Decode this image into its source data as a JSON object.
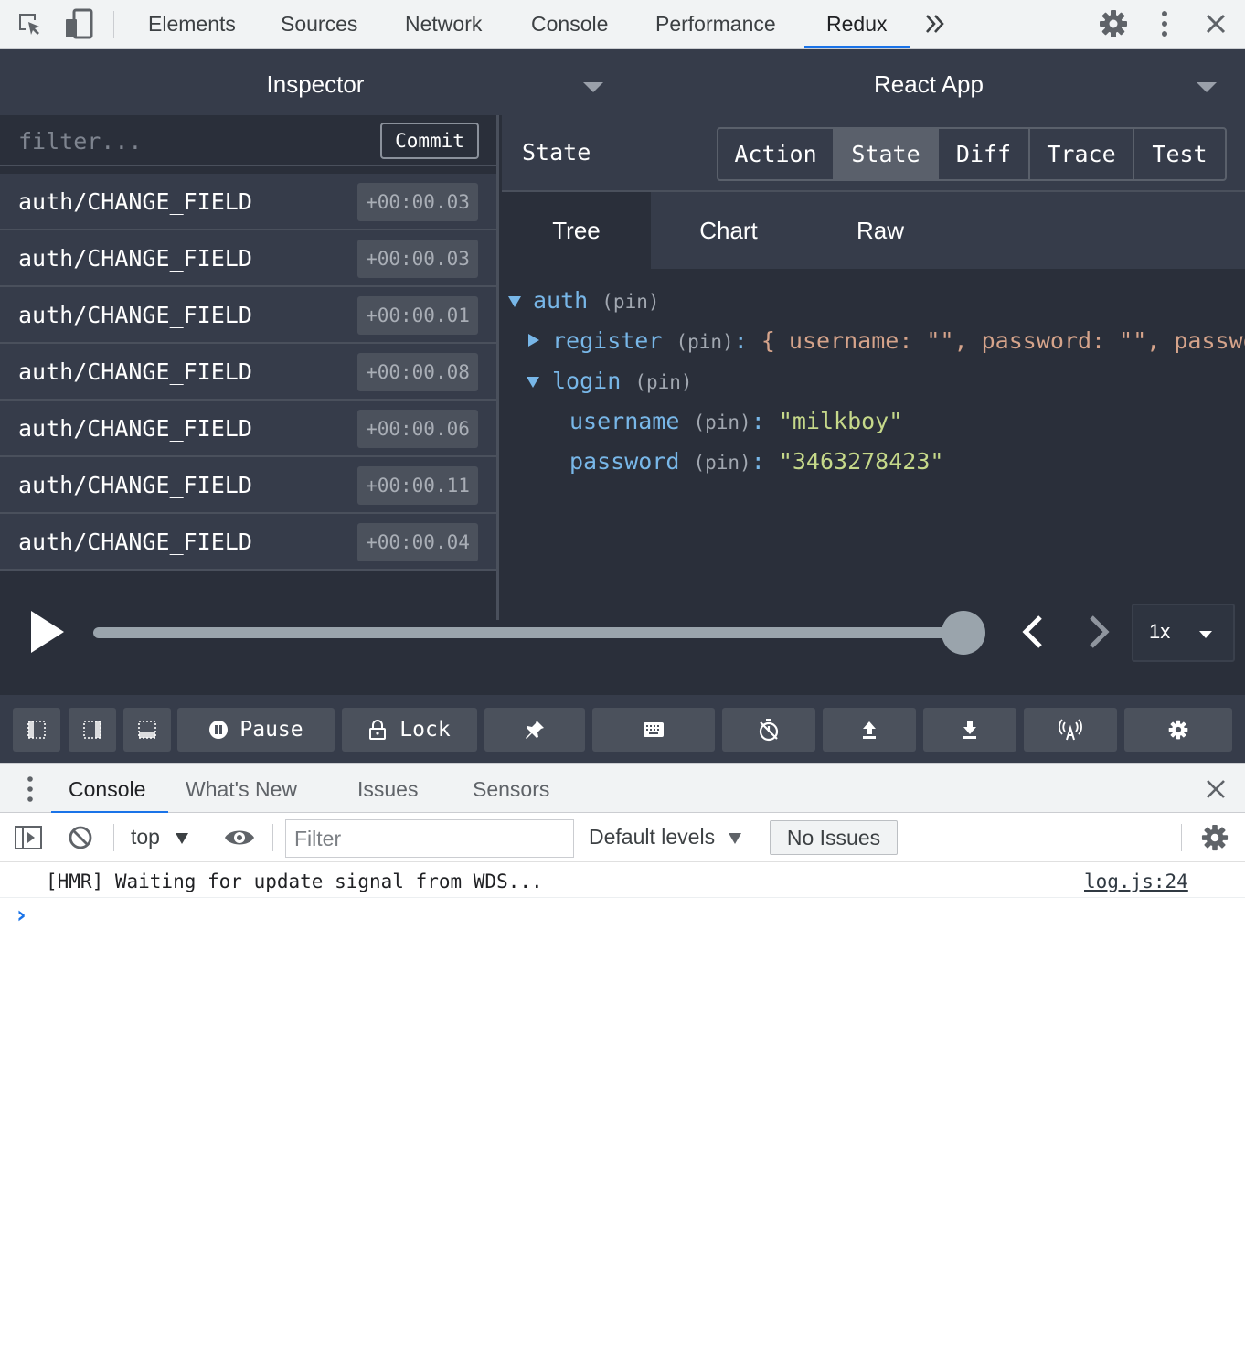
{
  "devtools": {
    "tabs": [
      "Elements",
      "Sources",
      "Network",
      "Console",
      "Performance",
      "Redux"
    ],
    "active_tab": "Redux"
  },
  "redux": {
    "monitor": "Inspector",
    "instance": "React App",
    "filter_placeholder": "filter...",
    "commit_label": "Commit",
    "actions": [
      {
        "name": "auth/CHANGE_FIELD",
        "time": "+00:00.03"
      },
      {
        "name": "auth/CHANGE_FIELD",
        "time": "+00:00.03"
      },
      {
        "name": "auth/CHANGE_FIELD",
        "time": "+00:00.01"
      },
      {
        "name": "auth/CHANGE_FIELD",
        "time": "+00:00.08"
      },
      {
        "name": "auth/CHANGE_FIELD",
        "time": "+00:00.06"
      },
      {
        "name": "auth/CHANGE_FIELD",
        "time": "+00:00.11"
      },
      {
        "name": "auth/CHANGE_FIELD",
        "time": "+00:00.04"
      }
    ],
    "panel_title": "State",
    "view_tabs": [
      "Action",
      "State",
      "Diff",
      "Trace",
      "Test"
    ],
    "active_view": "State",
    "sub_tabs": [
      "Tree",
      "Chart",
      "Raw"
    ],
    "active_sub_tab": "Tree",
    "tree": {
      "auth_key": "auth",
      "pin": "(pin)",
      "register_key": "register",
      "register_preview": "{ username: \"\", password: \"\", password",
      "login_key": "login",
      "username_key": "username",
      "username_value": "\"milkboy\"",
      "password_key": "password",
      "password_value": "\"3463278423\""
    },
    "slider_position": 1.0,
    "speed": "1x",
    "pause_label": "Pause",
    "lock_label": "Lock"
  },
  "drawer": {
    "tabs": [
      "Console",
      "What's New",
      "Issues",
      "Sensors"
    ],
    "active_tab": "Console",
    "context": "top",
    "filter_placeholder": "Filter",
    "levels": "Default levels",
    "issues": "No Issues",
    "log_message": "[HMR] Waiting for update signal from WDS...",
    "log_source": "log.js:24",
    "prompt": "›"
  },
  "colors": {
    "accent": "#1a73e8",
    "redux_bg": "#2a2f3a",
    "redux_panel": "#363c4a",
    "tree_key": "#78b7e8",
    "tree_string": "#c6d98a"
  }
}
